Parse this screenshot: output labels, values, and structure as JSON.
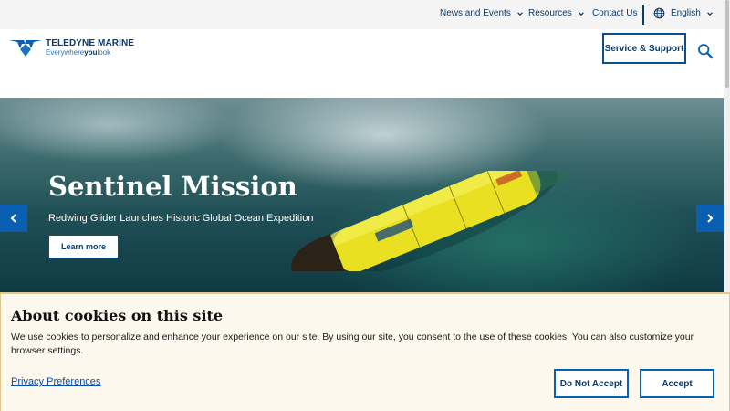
{
  "utility_nav": {
    "news_events": "News and Events",
    "resources": "Resources",
    "contact": "Contact Us",
    "language": "English"
  },
  "header": {
    "brand": "TELEDYNE MARINE",
    "tagline_prefix": "Everywhere",
    "tagline_bold": "you",
    "tagline_suffix": "look",
    "service_button": "Service & Support",
    "icons": [
      "teledyne-logo-icon",
      "search-icon",
      "globe-icon",
      "chevron-down-icon"
    ]
  },
  "hero": {
    "title": "Sentinel Mission",
    "subtitle": "Redwing Glider Launches Historic Global Ocean Expedition",
    "button": "Learn more",
    "icons": [
      "chevron-left-icon",
      "chevron-right-icon"
    ]
  },
  "cookie_banner": {
    "title": "About cookies on this site",
    "text": "We use cookies to personalize and enhance your experience on our site. By using our site, you consent to the use of these cookies. You can also customize your browser settings.",
    "privacy_link": "Privacy Preferences",
    "reject_button": "Do Not Accept",
    "accept_button": "Accept"
  },
  "colors": {
    "brand_navy": "#0b3a66",
    "accent_blue": "#0b5fb0",
    "banner_bg": "#fdf8ee"
  }
}
